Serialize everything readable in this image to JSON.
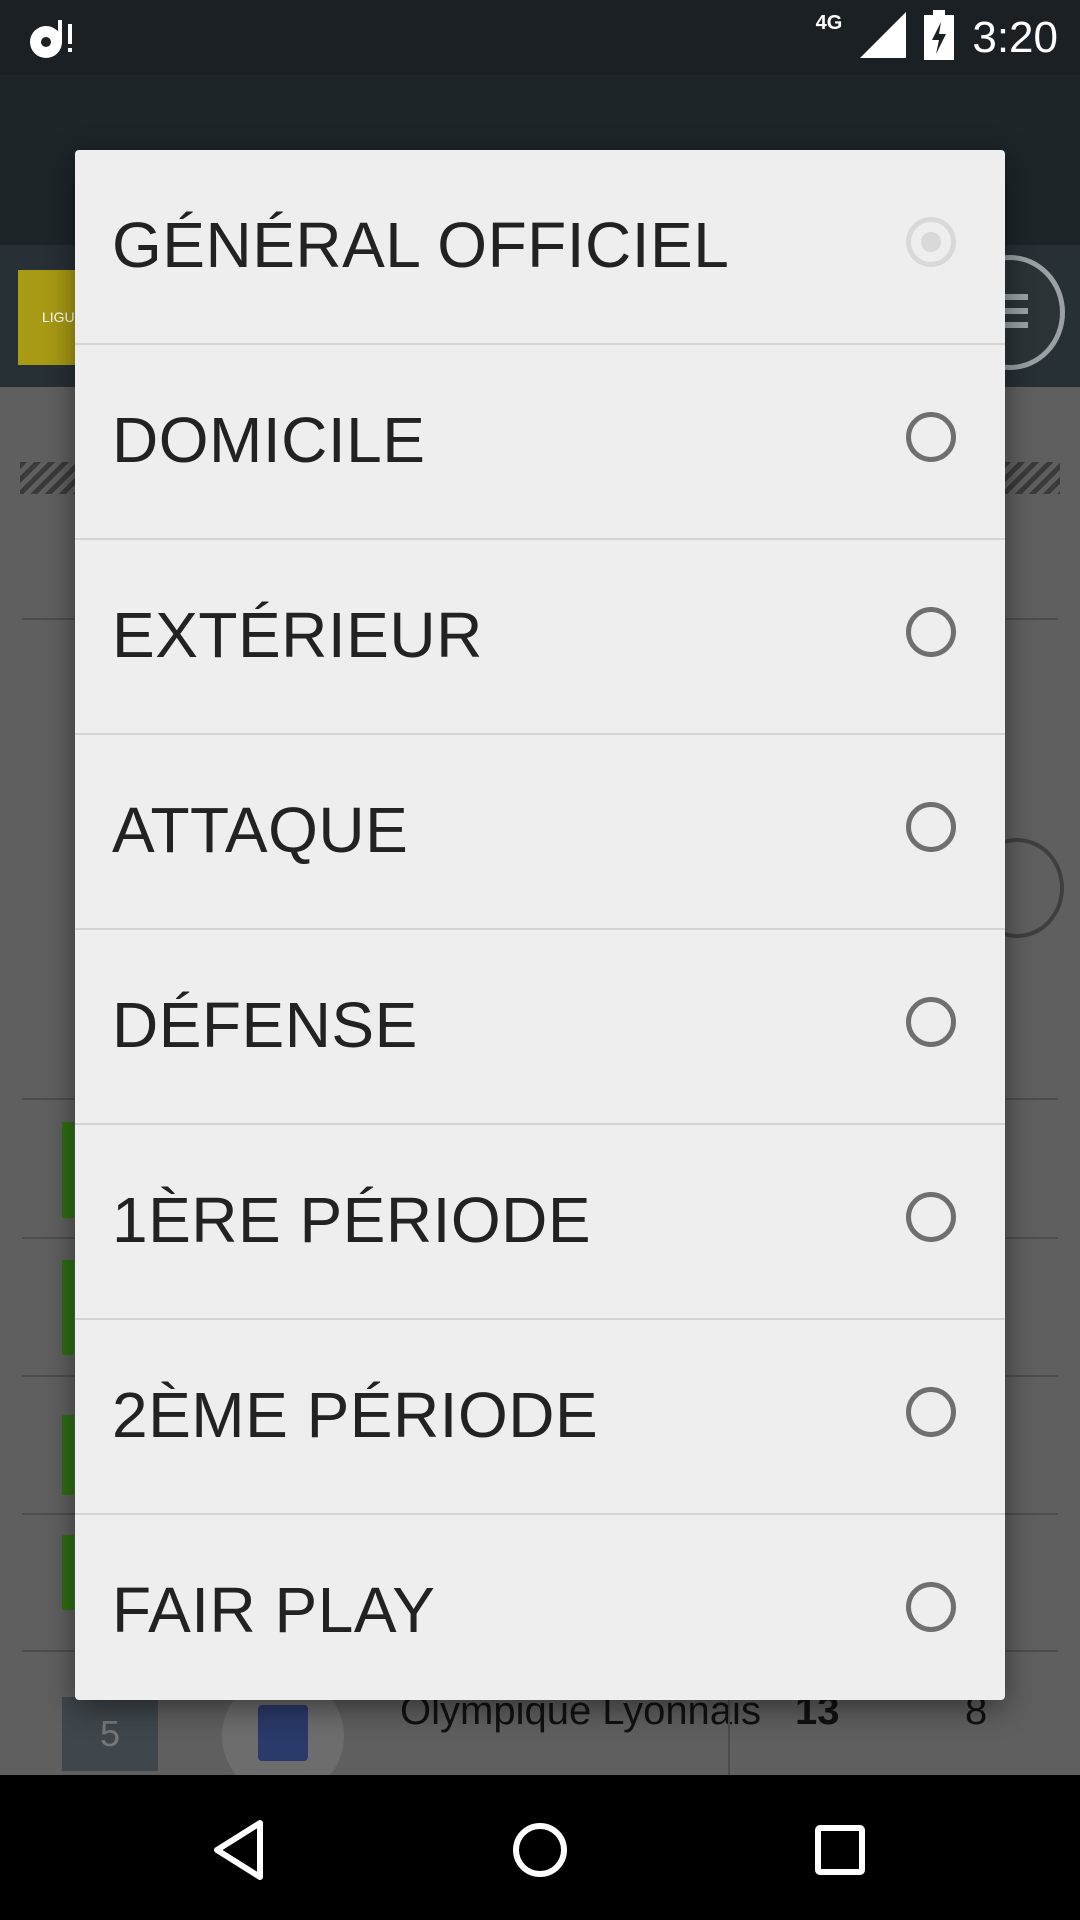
{
  "status_bar": {
    "time": "3:20",
    "network": "4G"
  },
  "background": {
    "logo_text": "LIGUE",
    "row": {
      "rank": "5",
      "team": "Olympique Lyonnais",
      "stat1": "13",
      "stat2": "8"
    }
  },
  "dialog": {
    "options": [
      {
        "label": "GÉNÉRAL OFFICIEL",
        "selected": true
      },
      {
        "label": "DOMICILE",
        "selected": false
      },
      {
        "label": "EXTÉRIEUR",
        "selected": false
      },
      {
        "label": "ATTAQUE",
        "selected": false
      },
      {
        "label": "DÉFENSE",
        "selected": false
      },
      {
        "label": "1ÈRE PÉRIODE",
        "selected": false
      },
      {
        "label": "2ÈME PÉRIODE",
        "selected": false
      },
      {
        "label": "FAIR PLAY",
        "selected": false
      }
    ]
  },
  "icons": {
    "notification": "music-notification-icon",
    "signal": "signal-icon",
    "battery": "battery-charging-icon",
    "back": "back-icon",
    "home": "home-icon",
    "recents": "recents-icon"
  }
}
